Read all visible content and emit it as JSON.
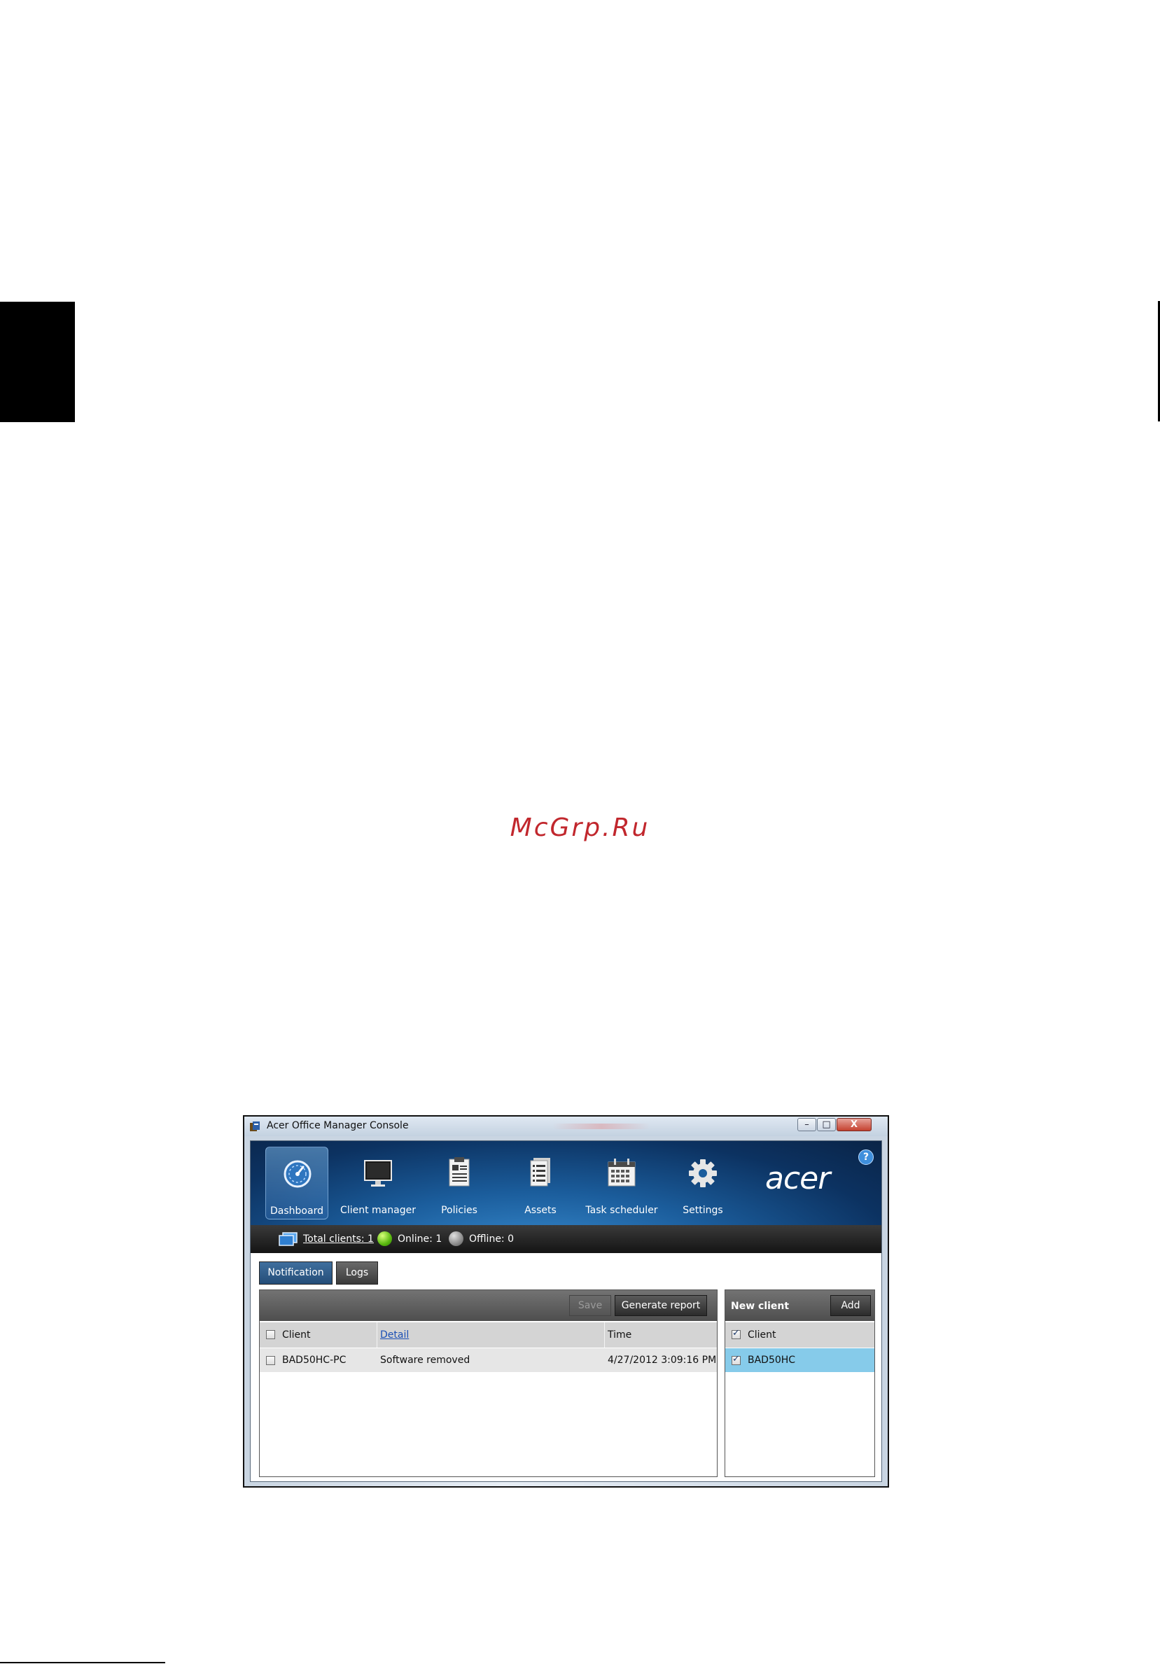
{
  "watermark": "McGrp.Ru",
  "window": {
    "title": "Acer Office Manager Console",
    "controls": {
      "minimize": "–",
      "maximize": "□",
      "close": "X"
    }
  },
  "nav": {
    "items": [
      {
        "label": "Dashboard",
        "icon": "dashboard-gauge-icon",
        "active": true
      },
      {
        "label": "Client manager",
        "icon": "monitor-icon"
      },
      {
        "label": "Policies",
        "icon": "clipboard-icon"
      },
      {
        "label": "Assets",
        "icon": "document-list-icon"
      },
      {
        "label": "Task scheduler",
        "icon": "calendar-icon"
      },
      {
        "label": "Settings",
        "icon": "gear-icon"
      }
    ],
    "logo": "acer",
    "help": "?"
  },
  "status": {
    "total_clients": "Total clients: 1",
    "online": "Online: 1",
    "offline": "Offline: 0",
    "colors": {
      "online": "#59b80f",
      "offline": "#8c8c8c"
    }
  },
  "tabs": {
    "notification": "Notification",
    "logs": "Logs"
  },
  "left_panel": {
    "save": "Save",
    "generate_report": "Generate report",
    "columns": {
      "client": "Client",
      "detail": "Detail",
      "time": "Time"
    },
    "rows": [
      {
        "client": "BAD50HC-PC",
        "detail": "Software removed",
        "time": "4/27/2012 3:09:16 PM",
        "checked": false
      }
    ]
  },
  "right_panel": {
    "title": "New client",
    "add": "Add",
    "column": "Client",
    "rows": [
      {
        "client": "BAD50HC",
        "checked": true
      }
    ]
  },
  "accent": "#1b5d9c"
}
